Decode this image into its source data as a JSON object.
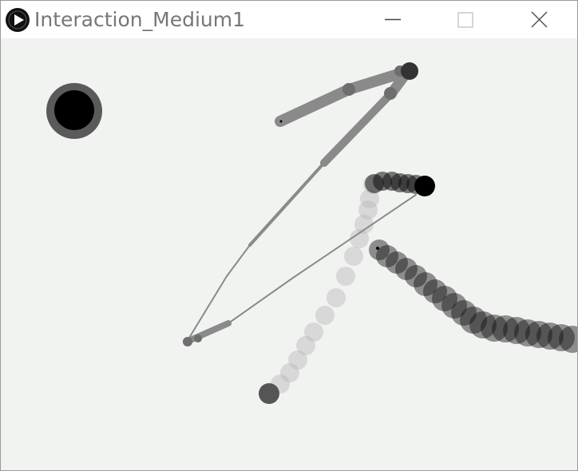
{
  "window": {
    "title": "Interaction_Medium1",
    "icons": {
      "app": "processing-play-icon",
      "minimize": "minimize-icon",
      "maximize": "maximize-icon",
      "close": "close-icon"
    }
  },
  "colors": {
    "canvas_background": "#f0f3f0",
    "title_text": "#777777",
    "stroke_gray": "#8a8a8a",
    "stroke_light": "#c4c4c4",
    "stroke_dark": "#1a1a1a",
    "indicator_ring": "#5a5a5a",
    "indicator_fill": "#000000"
  }
}
